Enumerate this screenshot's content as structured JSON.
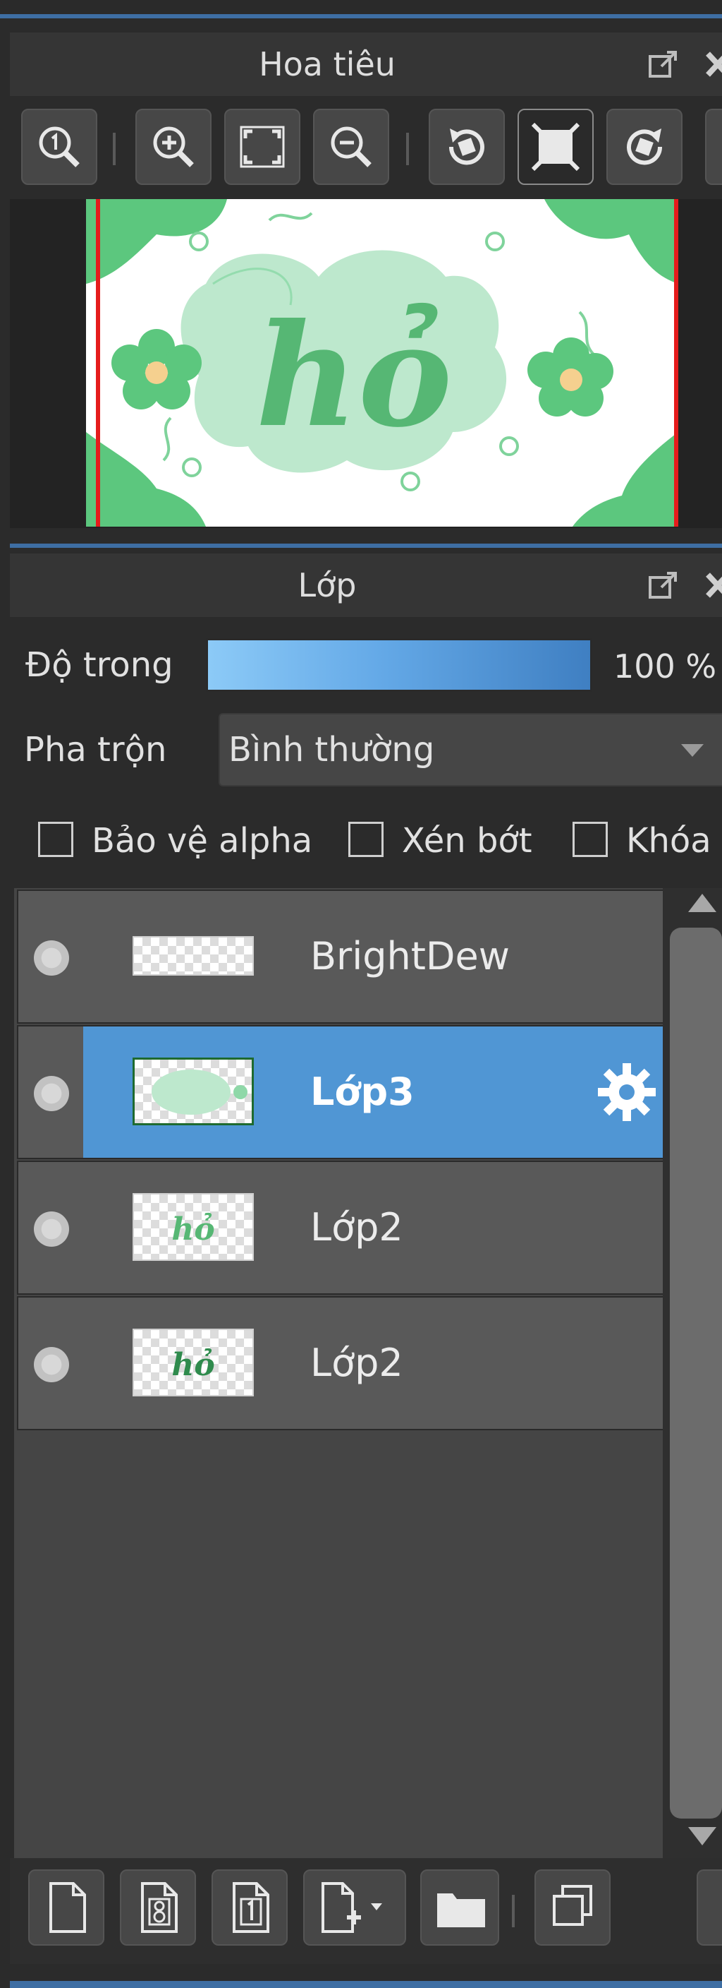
{
  "navigator": {
    "title": "Hoa tiêu",
    "preview_text": "hỏ",
    "toolbar": [
      {
        "icon": "zoom-actual-size-icon"
      },
      {
        "icon": "zoom-in-icon"
      },
      {
        "icon": "fit-to-window-icon"
      },
      {
        "icon": "zoom-out-icon"
      },
      {
        "icon": "rotate-left-icon"
      },
      {
        "icon": "reset-rotation-icon",
        "active": true
      },
      {
        "icon": "rotate-right-icon"
      }
    ]
  },
  "layers": {
    "title": "Lớp",
    "opacity_label": "Độ trong",
    "opacity_value": "100 %",
    "opacity_fraction": 1.0,
    "blend_label": "Pha trộn",
    "blend_value": "Bình thường",
    "checkboxes": [
      {
        "label": "Bảo vệ alpha",
        "checked": false
      },
      {
        "label": "Xén bớt",
        "checked": false
      },
      {
        "label": "Khóa",
        "checked": false
      }
    ],
    "list": [
      {
        "name": "BrightDew",
        "selected": false,
        "thumb_text": ""
      },
      {
        "name": "Lớp3",
        "selected": true,
        "thumb_text": ""
      },
      {
        "name": "Lớp2",
        "selected": false,
        "thumb_text": "hỏ"
      },
      {
        "name": "Lớp2",
        "selected": false,
        "thumb_text": "hỏ"
      }
    ]
  },
  "colors": {
    "accent": "#5096d4",
    "panel_bg": "#2b2b2b",
    "preview_green": "#5cc77e",
    "border_red": "#e51c1c"
  }
}
